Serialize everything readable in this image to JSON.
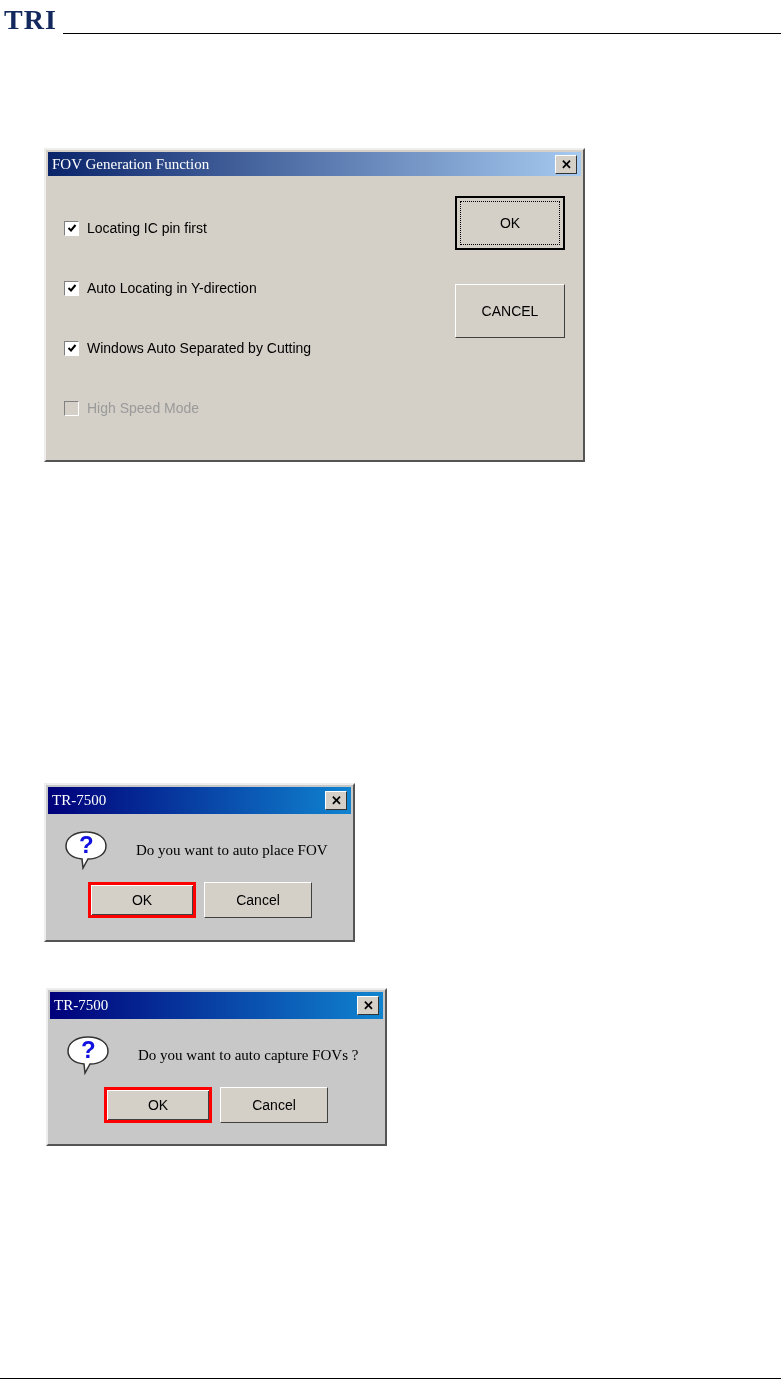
{
  "header": {
    "logo": "TRI"
  },
  "dialogs": [
    {
      "kind": "options",
      "title": "FOV Generation Function",
      "close": "✕",
      "options": [
        {
          "label": "Locating IC pin first",
          "checked": true,
          "disabled": false
        },
        {
          "label": "Auto Locating in Y-direction",
          "checked": true,
          "disabled": false
        },
        {
          "label": "Windows Auto Separated by Cutting",
          "checked": true,
          "disabled": false
        },
        {
          "label": "High Speed Mode",
          "checked": false,
          "disabled": true
        }
      ],
      "buttons": [
        {
          "label": "OK",
          "focused": true,
          "highlighted": false
        },
        {
          "label": "CANCEL",
          "focused": false,
          "highlighted": false
        }
      ]
    },
    {
      "kind": "message",
      "title": "TR-7500",
      "close": "✕",
      "icon": "?",
      "message": "Do you want to auto place FOV",
      "buttons": [
        {
          "label": "OK",
          "focused": false,
          "highlighted": true
        },
        {
          "label": "Cancel",
          "focused": false,
          "highlighted": false
        }
      ]
    },
    {
      "kind": "message",
      "title": "TR-7500",
      "close": "✕",
      "icon": "?",
      "message": "Do you want to auto capture FOVs ?",
      "buttons": [
        {
          "label": "OK",
          "focused": false,
          "highlighted": true
        },
        {
          "label": "Cancel",
          "focused": false,
          "highlighted": false
        }
      ]
    }
  ]
}
